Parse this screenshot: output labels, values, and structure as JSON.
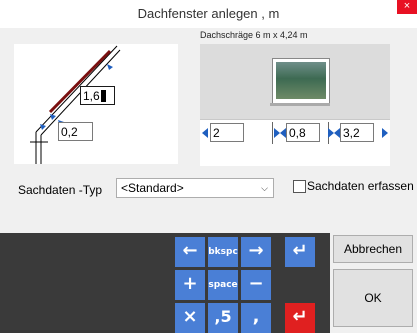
{
  "window": {
    "title": "Dachfenster anlegen , m",
    "close_glyph": "×"
  },
  "subtitle": "Dachschräge 6 m x 4,24 m",
  "slope": {
    "length": "1,6",
    "offset": "0,2"
  },
  "front": {
    "left": "2",
    "width": "0,8",
    "right": "3,2"
  },
  "sachdaten": {
    "label": "Sachdaten -Typ",
    "selected": "<Standard>",
    "checkbox_label": "Sachdaten erfassen",
    "checked": false
  },
  "keypad": {
    "bkspc": "bkspc",
    "space": "space",
    "comma5": ",5",
    "comma": ",",
    "plus": "+",
    "minus": "−",
    "times": "×",
    "arrow_left": "←",
    "arrow_right": "→",
    "enter": "↵"
  },
  "buttons": {
    "cancel": "Abbrechen",
    "ok": "OK"
  },
  "colors": {
    "key_blue": "#4a7fd6",
    "key_red": "#e02020",
    "keypad_bg": "#3a3a3a"
  }
}
